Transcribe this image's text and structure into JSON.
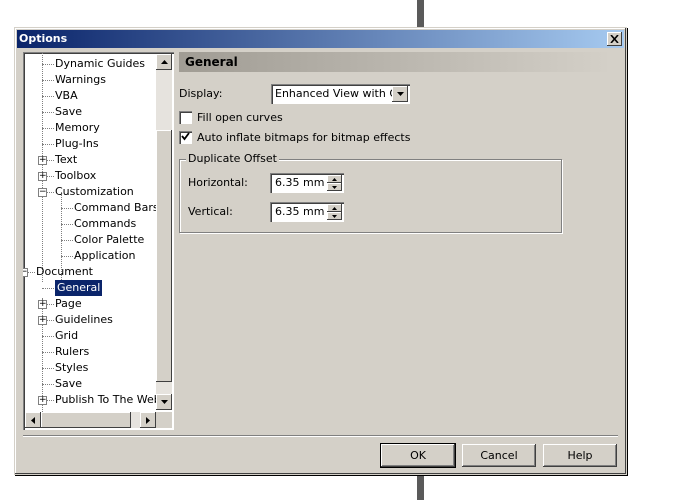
{
  "window": {
    "title": "Options"
  },
  "tree": {
    "items": [
      {
        "label": "Dynamic Guides",
        "level": 2
      },
      {
        "label": "Warnings",
        "level": 2
      },
      {
        "label": "VBA",
        "level": 2
      },
      {
        "label": "Save",
        "level": 2
      },
      {
        "label": "Memory",
        "level": 2
      },
      {
        "label": "Plug-Ins",
        "level": 2
      },
      {
        "label": "Text",
        "level": 2,
        "expander": "+"
      },
      {
        "label": "Toolbox",
        "level": 2,
        "expander": "+"
      },
      {
        "label": "Customization",
        "level": 2,
        "expander": "-"
      },
      {
        "label": "Command Bars",
        "level": 3
      },
      {
        "label": "Commands",
        "level": 3
      },
      {
        "label": "Color Palette",
        "level": 3
      },
      {
        "label": "Application",
        "level": 3
      },
      {
        "label": "Document",
        "level": 1,
        "expander": "-"
      },
      {
        "label": "General",
        "level": 2,
        "selected": true
      },
      {
        "label": "Page",
        "level": 2,
        "expander": "+"
      },
      {
        "label": "Guidelines",
        "level": 2,
        "expander": "+"
      },
      {
        "label": "Grid",
        "level": 2
      },
      {
        "label": "Rulers",
        "level": 2
      },
      {
        "label": "Styles",
        "level": 2
      },
      {
        "label": "Save",
        "level": 2
      },
      {
        "label": "Publish To The Web",
        "level": 2,
        "expander": "+"
      }
    ]
  },
  "panel": {
    "header": "General",
    "display_label": "Display:",
    "display_value": "Enhanced View with O...",
    "fill_open_curves": {
      "label": "Fill open curves",
      "checked": false
    },
    "auto_inflate": {
      "label": "Auto inflate bitmaps for bitmap effects",
      "checked": true
    },
    "duplicate_offset": {
      "title": "Duplicate Offset",
      "horizontal_label": "Horizontal:",
      "horizontal_value": "6.35 mm",
      "vertical_label": "Vertical:",
      "vertical_value": "6.35 mm"
    }
  },
  "buttons": {
    "ok": "OK",
    "cancel": "Cancel",
    "help": "Help"
  },
  "colors": {
    "title_start": "#0a246a",
    "title_end": "#a6caf0",
    "face": "#d4d0c8",
    "selection": "#0a246a"
  }
}
